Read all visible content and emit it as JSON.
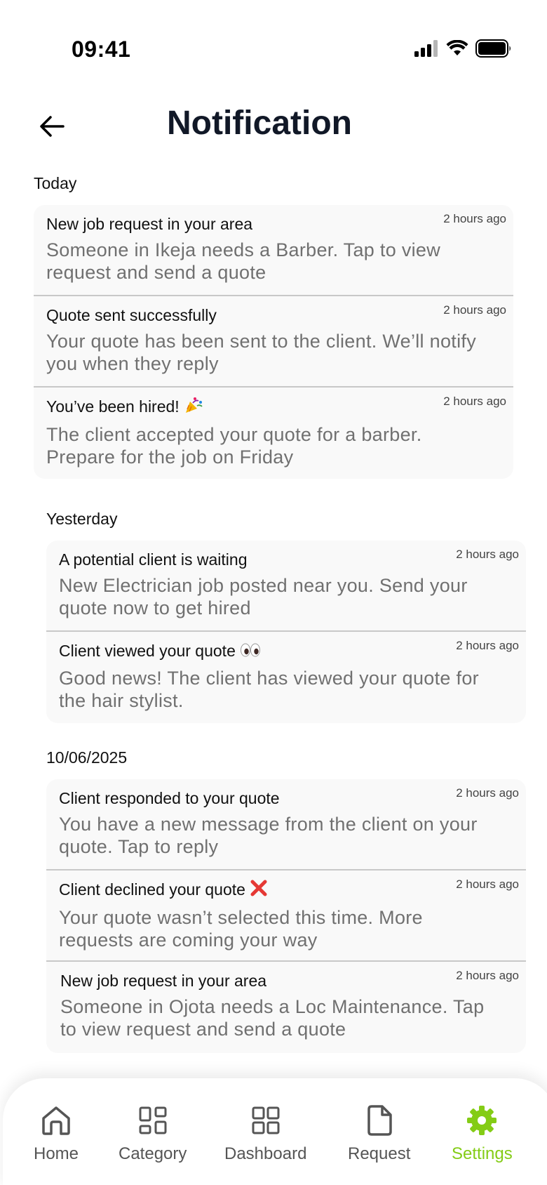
{
  "status": {
    "time": "09:41"
  },
  "header": {
    "title": "Notification"
  },
  "sections": [
    {
      "label": "Today",
      "items": [
        {
          "title": "New job request in your area",
          "time": "2 hours ago",
          "body": "Someone in Ikeja needs a Barber. Tap to view request and send a quote"
        },
        {
          "title": "Quote sent successfully",
          "time": "2 hours ago",
          "body": "Your quote has been sent to the client. We’ll notify you when they reply"
        },
        {
          "title": "You’ve been hired!",
          "time": "2 hours ago",
          "body": "The client accepted your quote for a barber. Prepare for the job on Friday"
        }
      ]
    },
    {
      "label": "Yesterday",
      "items": [
        {
          "title": "A potential client is waiting",
          "time": "2 hours ago",
          "body": "New Electrician job posted near you. Send your quote now to get hired"
        },
        {
          "title": "Client viewed your quote",
          "time": "2 hours ago",
          "body": "Good news! The client has viewed your quote for the hair stylist."
        }
      ]
    },
    {
      "label": "10/06/2025",
      "items": [
        {
          "title": "Client responded to your quote",
          "time": "2 hours ago",
          "body": "You have a new message from the client on your quote. Tap to reply"
        },
        {
          "title": "Client declined your quote",
          "time": "2 hours ago",
          "body": "Your quote wasn’t selected this time. More requests are coming your way"
        },
        {
          "title": "New job request in your area",
          "time": "2 hours ago",
          "body": "Someone in Ojota needs a Loc Maintenance. Tap to view request and send a quote"
        }
      ]
    }
  ],
  "nav": {
    "items": [
      {
        "label": "Home",
        "icon": "home-icon"
      },
      {
        "label": "Category",
        "icon": "category-icon"
      },
      {
        "label": "Dashboard",
        "icon": "dashboard-icon"
      },
      {
        "label": "Request",
        "icon": "document-icon"
      },
      {
        "label": "Settings",
        "icon": "gear-icon",
        "active": true
      }
    ],
    "active_color": "#84cc16"
  }
}
